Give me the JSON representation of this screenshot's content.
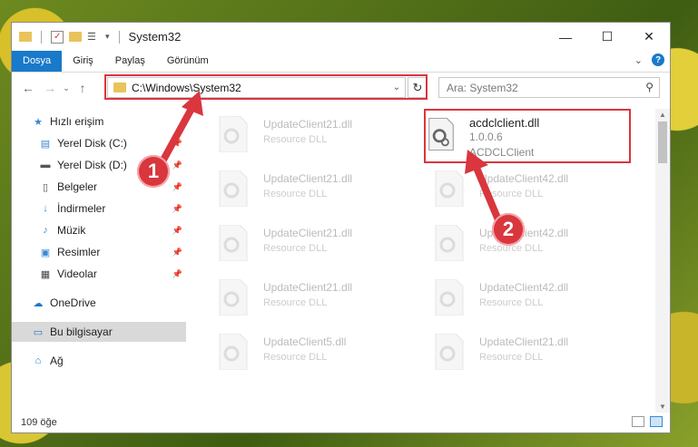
{
  "window": {
    "title": "System32"
  },
  "ribbon": {
    "tabs": [
      {
        "label": "Dosya",
        "active": true
      },
      {
        "label": "Giriş"
      },
      {
        "label": "Paylaş"
      },
      {
        "label": "Görünüm"
      }
    ]
  },
  "address": {
    "path": "C:\\Windows\\System32"
  },
  "search": {
    "placeholder": "Ara: System32"
  },
  "sidebar": {
    "items": [
      {
        "label": "Hızlı erişim",
        "icon": "star-icon"
      },
      {
        "label": "Yerel Disk (C:)",
        "icon": "drive-icon",
        "pinned": true
      },
      {
        "label": "Yerel Disk (D:)",
        "icon": "drive-icon",
        "pinned": true
      },
      {
        "label": "Belgeler",
        "icon": "documents-icon",
        "pinned": true
      },
      {
        "label": "İndirmeler",
        "icon": "downloads-icon",
        "pinned": true
      },
      {
        "label": "Müzik",
        "icon": "music-icon",
        "pinned": true
      },
      {
        "label": "Resimler",
        "icon": "pictures-icon",
        "pinned": true
      },
      {
        "label": "Videolar",
        "icon": "videos-icon",
        "pinned": true
      },
      {
        "label": "OneDrive",
        "icon": "cloud-icon"
      },
      {
        "label": "Bu bilgisayar",
        "icon": "computer-icon",
        "selected": true
      },
      {
        "label": "Ağ",
        "icon": "network-icon"
      }
    ]
  },
  "files": {
    "left": [
      {
        "name": "UpdateClient21.dll",
        "type": "Resource DLL"
      },
      {
        "name": "UpdateClient21.dll",
        "type": "Resource DLL"
      },
      {
        "name": "UpdateClient21.dll",
        "type": "Resource DLL"
      },
      {
        "name": "UpdateClient21.dll",
        "type": "Resource DLL"
      },
      {
        "name": "UpdateClient5.dll",
        "type": "Resource DLL"
      }
    ],
    "right": [
      {
        "name": "acdclclient.dll",
        "version": "1.0.0.6",
        "description": "ACDCLClient",
        "highlighted": true
      },
      {
        "name": "UpdateClient42.dll",
        "type": "Resource DLL"
      },
      {
        "name": "UpdateClient42.dll",
        "type": "Resource DLL"
      },
      {
        "name": "UpdateClient42.dll",
        "type": "Resource DLL"
      },
      {
        "name": "UpdateClient21.dll",
        "type": "Resource DLL"
      }
    ]
  },
  "status": {
    "count": "109 öğe"
  },
  "annotations": {
    "callout1": "1",
    "callout2": "2"
  },
  "colors": {
    "accent": "#1979ca",
    "highlight": "#d9363e"
  }
}
